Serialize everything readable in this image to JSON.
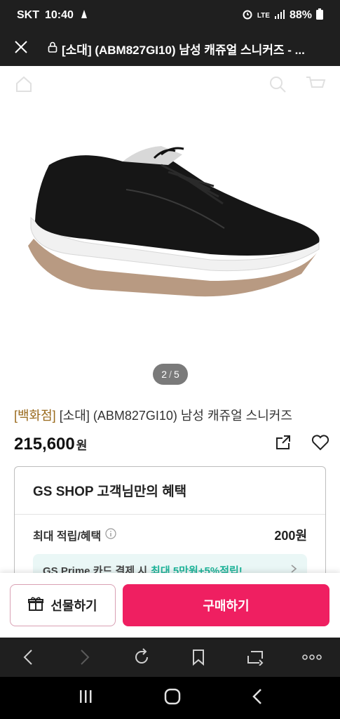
{
  "status_bar": {
    "carrier": "SKT",
    "time": "10:40",
    "network": "LTE",
    "battery": "88%"
  },
  "browser_bar": {
    "page_title": "[소대] (ABM827GI10) 남성 캐쥬얼 스니커즈 - ..."
  },
  "product": {
    "image_pager": {
      "current": "2",
      "total": "5"
    },
    "department_tag": "[백화점]",
    "name": "[소대] (ABM827GI10) 남성 캐쥬얼 스니커즈",
    "price": "215,600",
    "price_unit": "원"
  },
  "benefits": {
    "title": "GS SHOP 고객님만의 혜택",
    "max_reward_label": "최대 적립/혜택",
    "max_reward_value": "200원",
    "prime_banner_text": "GS Prime 카드 결제 시",
    "prime_banner_highlight": "최대 5만원+5%적립!"
  },
  "cta": {
    "gift_label": "선물하기",
    "buy_label": "구매하기"
  },
  "colors": {
    "accent_pink": "#ef1f61",
    "department_gold": "#9a6a1c",
    "prime_green": "#1fb59a"
  }
}
